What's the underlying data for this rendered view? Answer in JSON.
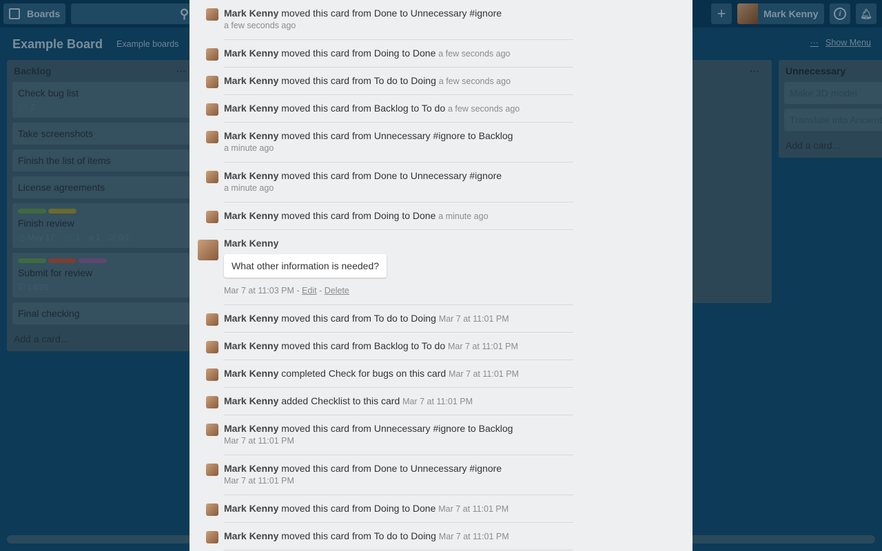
{
  "header": {
    "boards_label": "Boards",
    "user_name": "Mark Kenny",
    "icons": [
      "boards-icon",
      "search-icon",
      "plus-icon",
      "info-icon",
      "bell-icon"
    ]
  },
  "board": {
    "title": "Example Board",
    "team_link": "Example boards",
    "menu_label": "Show Menu"
  },
  "lists": [
    {
      "name": "Backlog",
      "cards": [
        {
          "title": "Check bug list",
          "badges": [
            "2"
          ]
        },
        {
          "title": "Take screenshots"
        },
        {
          "title": "Finish the list of items"
        },
        {
          "title": "License agreements"
        },
        {
          "title": "Finish review",
          "labels": [
            "#3f6a3f",
            "#6b6a2e"
          ],
          "badges": [
            "May 17",
            "1",
            "1",
            "0/1"
          ]
        },
        {
          "title": "Submit for review",
          "labels": [
            "#3f6a3f",
            "#7a3e34",
            "#5e4670"
          ],
          "badges": [
            "14/20"
          ]
        },
        {
          "title": "Final checking"
        }
      ],
      "add": "Add a card..."
    },
    {
      "name": "Unnecessary",
      "cards": [
        {
          "title": "Make 3D model"
        },
        {
          "title": "Translate into Ancient"
        }
      ],
      "add": "Add a card..."
    }
  ],
  "activity": [
    {
      "user": "Mark Kenny",
      "action": "moved this card from Done to Unnecessary #ignore",
      "time": "a few seconds ago",
      "block": true
    },
    {
      "user": "Mark Kenny",
      "action": "moved this card from Doing to Done",
      "time": "a few seconds ago"
    },
    {
      "user": "Mark Kenny",
      "action": "moved this card from To do to Doing",
      "time": "a few seconds ago"
    },
    {
      "user": "Mark Kenny",
      "action": "moved this card from Backlog to To do",
      "time": "a few seconds ago"
    },
    {
      "user": "Mark Kenny",
      "action": "moved this card from Unnecessary #ignore to Backlog",
      "time": "a minute ago",
      "block": true
    },
    {
      "user": "Mark Kenny",
      "action": "moved this card from Done to Unnecessary #ignore",
      "time": "a minute ago",
      "block": true
    },
    {
      "user": "Mark Kenny",
      "action": "moved this card from Doing to Done",
      "time": "a minute ago"
    }
  ],
  "comment": {
    "user": "Mark Kenny",
    "text": "What other information is needed?",
    "time": "Mar 7 at 11:03 PM",
    "edit": "Edit",
    "delete": "Delete",
    "sep": "-"
  },
  "activity2": [
    {
      "user": "Mark Kenny",
      "action": "moved this card from To do to Doing",
      "time": "Mar 7 at 11:01 PM"
    },
    {
      "user": "Mark Kenny",
      "action": "moved this card from Backlog to To do",
      "time": "Mar 7 at 11:01 PM"
    },
    {
      "user": "Mark Kenny",
      "action": "completed Check for bugs on this card",
      "time": "Mar 7 at 11:01 PM"
    },
    {
      "user": "Mark Kenny",
      "action": "added Checklist to this card",
      "time": "Mar 7 at 11:01 PM"
    },
    {
      "user": "Mark Kenny",
      "action": "moved this card from Unnecessary #ignore to Backlog",
      "time": "Mar 7 at 11:01 PM",
      "block": true
    },
    {
      "user": "Mark Kenny",
      "action": "moved this card from Done to Unnecessary #ignore",
      "time": "Mar 7 at 11:01 PM",
      "block": true
    },
    {
      "user": "Mark Kenny",
      "action": "moved this card from Doing to Done",
      "time": "Mar 7 at 11:01 PM"
    },
    {
      "user": "Mark Kenny",
      "action": "moved this card from To do to Doing",
      "time": "Mar 7 at 11:01 PM"
    }
  ]
}
